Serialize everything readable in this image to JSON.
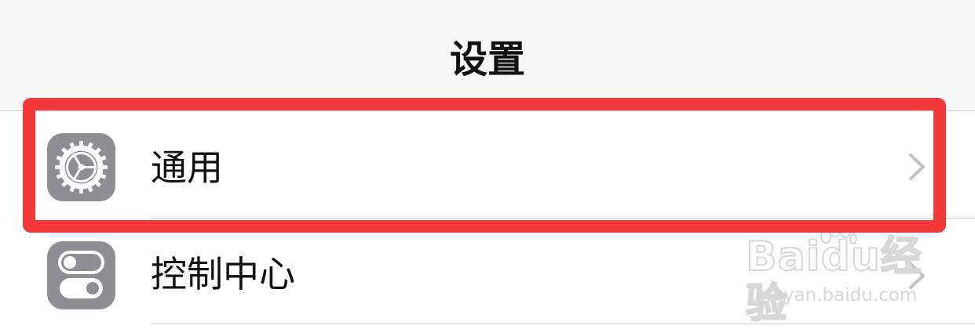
{
  "nav": {
    "title": "设置"
  },
  "rows": [
    {
      "label": "通用",
      "icon": "gear-icon"
    },
    {
      "label": "控制中心",
      "icon": "switches-icon"
    }
  ],
  "highlight": {
    "color": "#f5373a",
    "target": "通用"
  },
  "watermark": {
    "brand": "Bai",
    "brand_suffix": "du",
    "product": "经验",
    "url": "jingyan.baidu.com"
  },
  "colors": {
    "icon_bg": "#8e8e93",
    "separator": "#d2d2d6",
    "chevron": "#c4c4c7",
    "navbar_bg": "#f7f7f8"
  }
}
